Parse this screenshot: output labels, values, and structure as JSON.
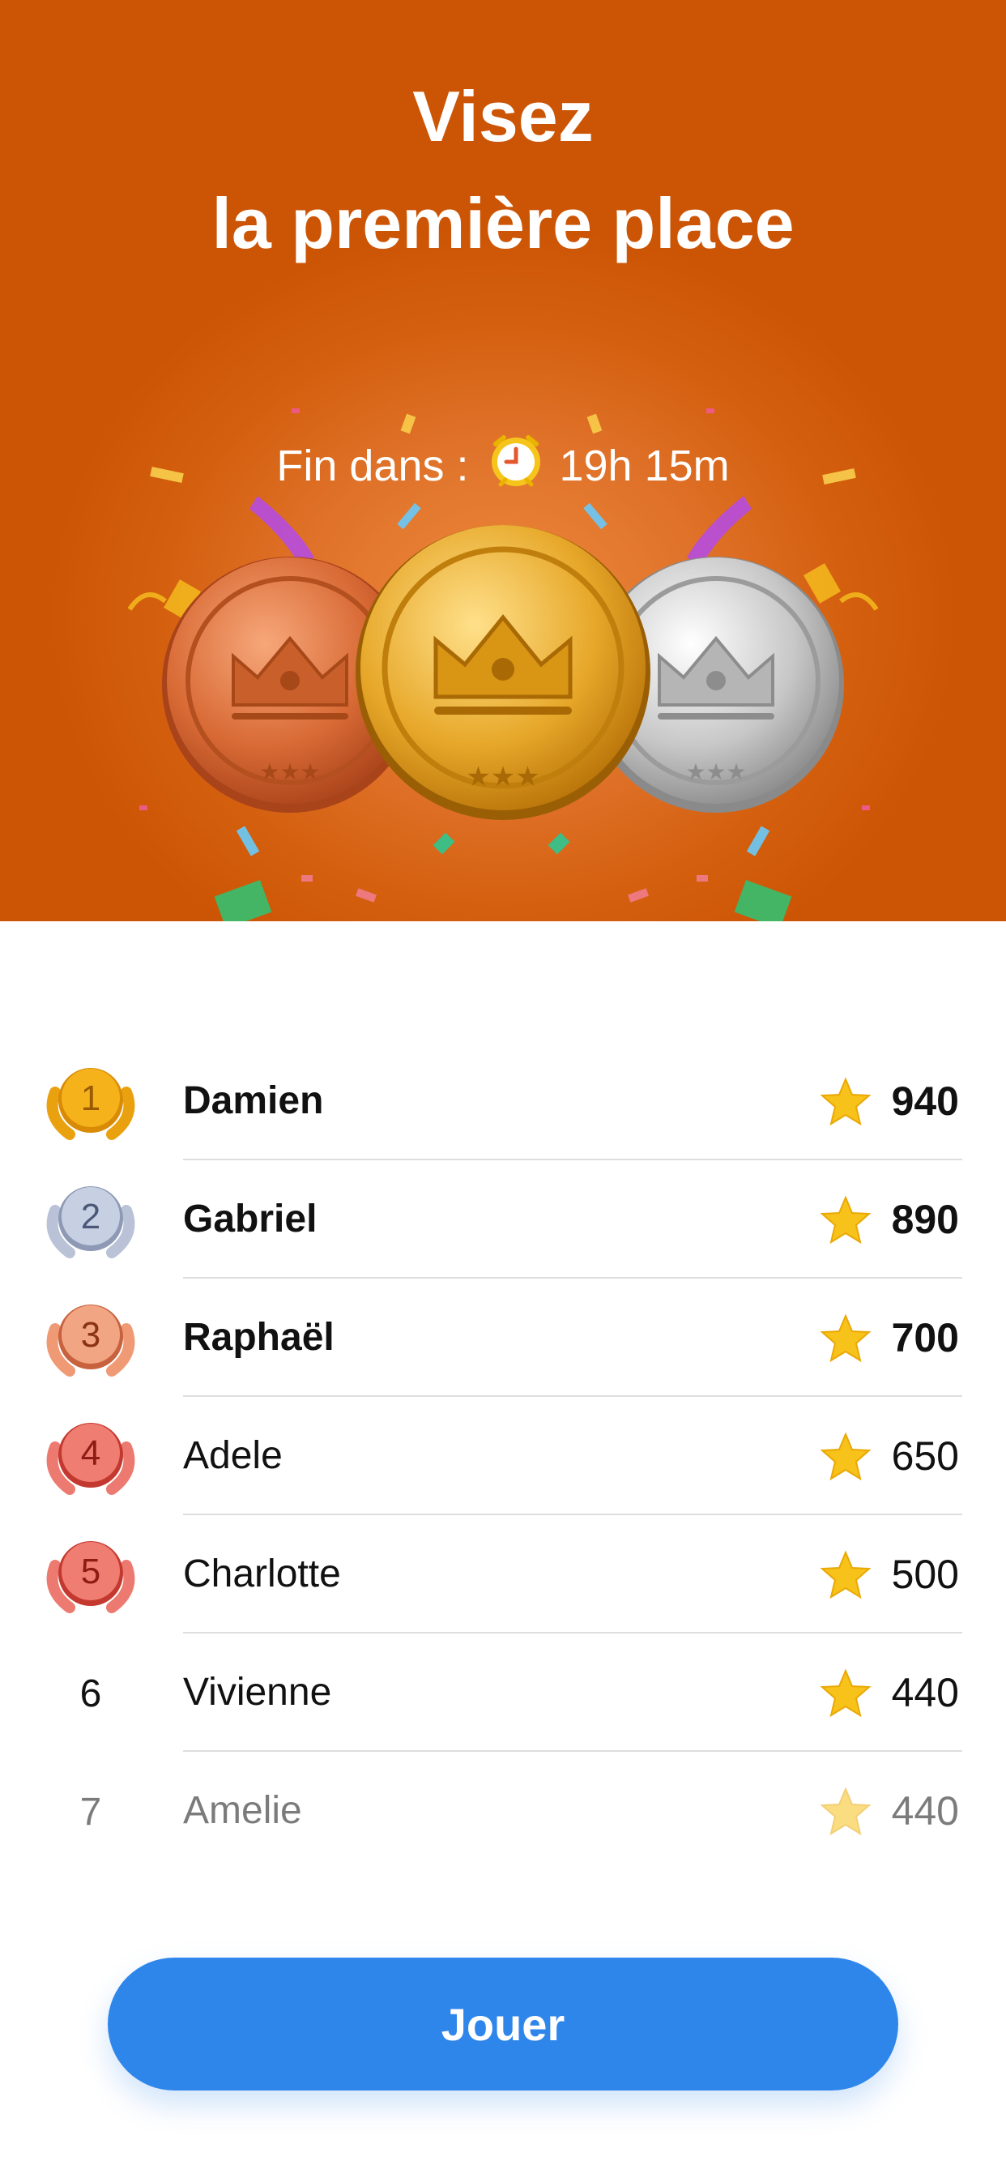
{
  "header": {
    "title_line1": "Visez",
    "title_line2": "la première place",
    "timer_label": "Fin dans :",
    "timer_value": "19h 15m",
    "timer_icon": "alarm-clock-icon",
    "medals": [
      "bronze-medal",
      "gold-medal",
      "silver-medal"
    ]
  },
  "leaderboard": [
    {
      "rank": "1",
      "name": "Damien",
      "score": "940",
      "badge_color": "#f6b21b",
      "badge_dark": "#d98b06"
    },
    {
      "rank": "2",
      "name": "Gabriel",
      "score": "890",
      "badge_color": "#c7d0e3",
      "badge_dark": "#8e9ab5"
    },
    {
      "rank": "3",
      "name": "Raphaël",
      "score": "700",
      "badge_color": "#f2a583",
      "badge_dark": "#c8623e"
    },
    {
      "rank": "4",
      "name": "Adele",
      "score": "650",
      "badge_color": "#f07d72",
      "badge_dark": "#c4392f"
    },
    {
      "rank": "5",
      "name": "Charlotte",
      "score": "500",
      "badge_color": "#f07d72",
      "badge_dark": "#c4392f"
    },
    {
      "rank": "6",
      "name": "Vivienne",
      "score": "440"
    },
    {
      "rank": "7",
      "name": "Amelie",
      "score": "440"
    }
  ],
  "cta": {
    "label": "Jouer"
  },
  "colors": {
    "hero_bg": "#d4600f",
    "cta_bg": "#2f86ea",
    "star": "#f7c21a"
  }
}
